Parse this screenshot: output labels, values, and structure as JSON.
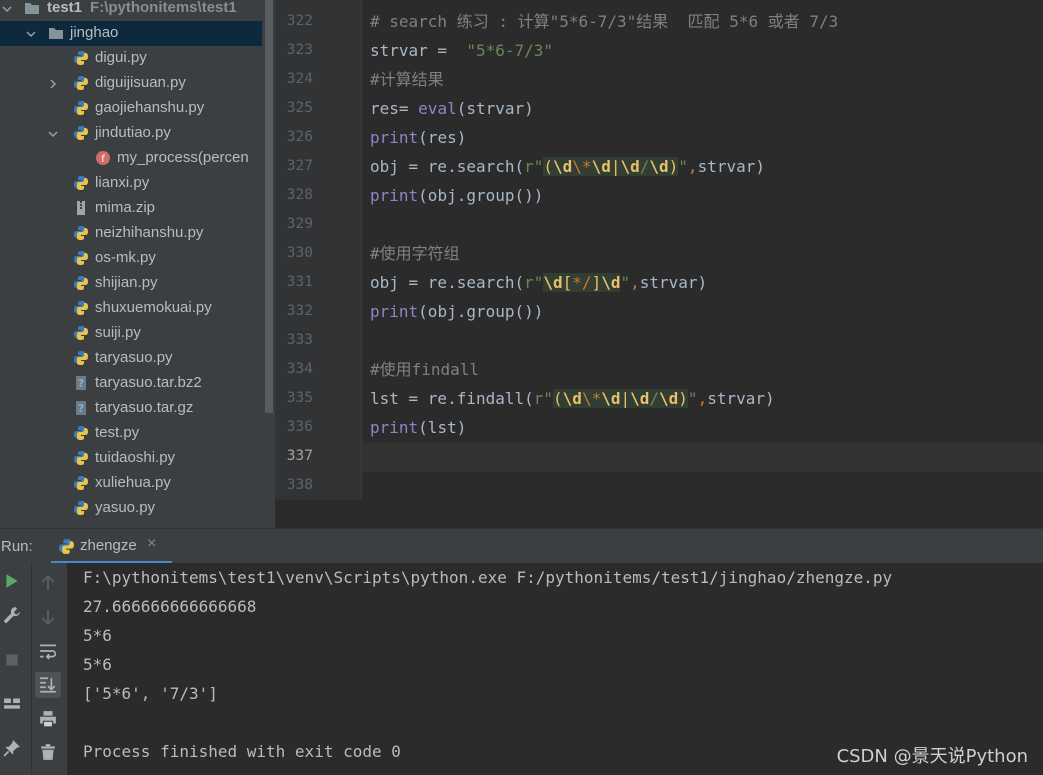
{
  "project_tree": {
    "root": {
      "name": "test1",
      "path": "F:\\pythonitems\\test1"
    },
    "folder": {
      "name": "jinghao"
    },
    "items": [
      {
        "label": "digui.py"
      },
      {
        "label": "diguijisuan.py"
      },
      {
        "label": "gaojiehanshu.py"
      },
      {
        "label": "jindutiao.py"
      },
      {
        "label": "my_process(percen"
      },
      {
        "label": "lianxi.py"
      },
      {
        "label": "mima.zip"
      },
      {
        "label": "neizhihanshu.py"
      },
      {
        "label": "os-mk.py"
      },
      {
        "label": "shijian.py"
      },
      {
        "label": "shuxuemokuai.py"
      },
      {
        "label": "suiji.py"
      },
      {
        "label": "taryasuo.py"
      },
      {
        "label": "taryasuo.tar.bz2"
      },
      {
        "label": "taryasuo.tar.gz"
      },
      {
        "label": "test.py"
      },
      {
        "label": "tuidaoshi.py"
      },
      {
        "label": "xuliehua.py"
      },
      {
        "label": "yasuo.py"
      }
    ]
  },
  "editor": {
    "line_numbers": [
      "322",
      "323",
      "324",
      "325",
      "326",
      "327",
      "328",
      "329",
      "330",
      "331",
      "332",
      "333",
      "334",
      "335",
      "336",
      "337",
      "338"
    ],
    "active_line": "337",
    "code": {
      "l322": "# search 练习 : 计算\"5*6-7/3\"结果  匹配 5*6 或者 7/3",
      "l323_a": "strvar =  ",
      "l323_b": "\"5*6-7/3\"",
      "l324": "#计算结果",
      "l325_a": "res= ",
      "l325_b": "eval",
      "l325_c": "(strvar)",
      "l326_a": "print",
      "l326_b": "(res)",
      "l327_a": "obj = re.search(",
      "l327_b": "r\"",
      "l327_rx": [
        "(",
        "\\d",
        "\\*",
        "\\d",
        "|",
        "\\d",
        "/",
        "\\d",
        ")"
      ],
      "l327_c": "\"",
      "l327_d": ",",
      "l327_e": "strvar)",
      "l328_a": "print",
      "l328_b": "(obj.group())",
      "l330": "#使用字符组",
      "l331_a": "obj = re.search(",
      "l331_b": "r\"",
      "l331_rx": [
        "\\d",
        "[",
        "*/",
        "]",
        "\\d"
      ],
      "l331_c": "\"",
      "l331_d": ",",
      "l331_e": "strvar)",
      "l332_a": "print",
      "l332_b": "(obj.group())",
      "l334": "#使用findall",
      "l335_a": "lst = re.findall(",
      "l335_b": "r\"",
      "l335_rx": [
        "(",
        "\\d",
        "\\*",
        "\\d",
        "|",
        "\\d",
        "/",
        "\\d",
        ")"
      ],
      "l335_c": "\"",
      "l335_d": ",",
      "l335_e": "strvar)",
      "l336_a": "print",
      "l336_b": "(lst)"
    }
  },
  "run_panel": {
    "label": "Run:",
    "tab_name": "zhengze",
    "tab_close": "×",
    "output": [
      "F:\\pythonitems\\test1\\venv\\Scripts\\python.exe F:/pythonitems/test1/jinghao/zhengze.py",
      "27.666666666666668",
      "5*6",
      "5*6",
      "['5*6', '7/3']",
      "",
      "Process finished with exit code 0"
    ]
  },
  "watermark": "CSDN @景天说Python",
  "colors": {
    "tree_bg": "#3c3f41",
    "editor_bg": "#2b2b2b",
    "selection": "#0d293e",
    "keyword": "#8888c6",
    "string": "#6a8759",
    "comment": "#808080",
    "regex_group": "#e8bf6a",
    "regex_escape": "#cc7832",
    "run_accent": "#59a869"
  }
}
